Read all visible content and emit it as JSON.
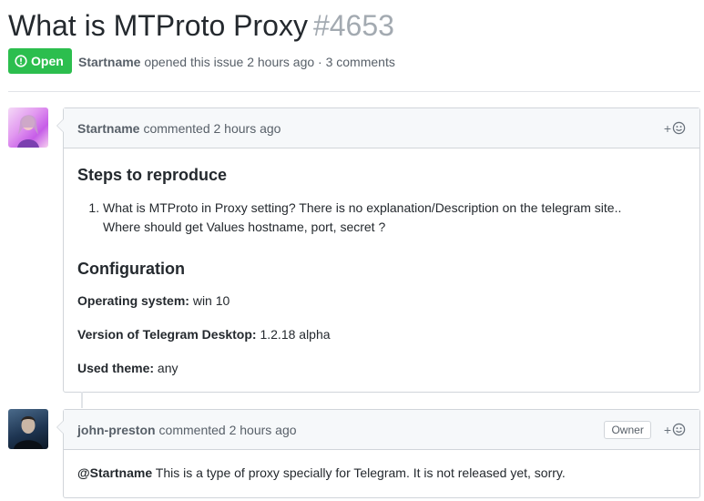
{
  "issue": {
    "title": "What is MTProto Proxy",
    "number": "#4653",
    "state": "Open",
    "author": "Startname",
    "meta_text": "opened this issue 2 hours ago · 3 comments"
  },
  "comments": [
    {
      "author": "Startname",
      "action": "commented 2 hours ago",
      "body": {
        "h1": "Steps to reproduce",
        "list": [
          "What is MTProto in Proxy setting? There is no explanation/Description on the telegram site..",
          "Where should get Values hostname, port, secret ?"
        ],
        "h2": "Configuration",
        "fields": [
          {
            "label": "Operating system:",
            "value": " win 10"
          },
          {
            "label": "Version of Telegram Desktop:",
            "value": " 1.2.18 alpha"
          },
          {
            "label": "Used theme:",
            "value": " any"
          }
        ]
      }
    },
    {
      "author": "john-preston",
      "action": "commented 2 hours ago",
      "badge": "Owner",
      "mention": "@Startname",
      "text": " This is a type of proxy specially for Telegram. It is not released yet, sorry."
    }
  ],
  "reaction_plus": "+",
  "colors": {
    "open_green": "#2cbe4e"
  }
}
